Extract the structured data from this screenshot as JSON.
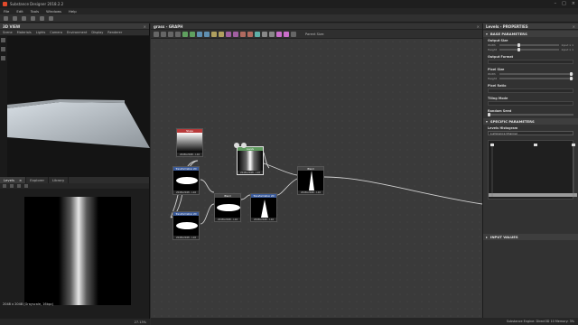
{
  "window": {
    "title": "Substance Designer 2018.2.2"
  },
  "menu": [
    "File",
    "Edit",
    "Tools",
    "Windows",
    "Help"
  ],
  "view3d": {
    "title": "3D VIEW",
    "submenu": [
      "Scene",
      "Materials",
      "Lights",
      "Camera",
      "Environment",
      "Display",
      "Renderer"
    ]
  },
  "view2d": {
    "tabs": [
      "Levels",
      "Explorer",
      "Library"
    ],
    "info": "2048 x 2048 (Grayscale, 16bpc)",
    "zoom": "27.13%"
  },
  "graph": {
    "title": "grass - GRAPH",
    "parent_size_label": "Parent Size:",
    "nodes": [
      {
        "name": "Shape",
        "caption": "2048x2048 - L16"
      },
      {
        "name": "Transformation 2D",
        "caption": "2048x2048 - L16"
      },
      {
        "name": "Transformation 2D",
        "caption": "2048x2048 - L16"
      },
      {
        "name": "Blend",
        "caption": "2048x2048 - L16"
      },
      {
        "name": "Transformation 2D",
        "caption": "2048x2048 - L16"
      },
      {
        "name": "Levels",
        "caption": "2048x2048 - L16"
      },
      {
        "name": "Blend",
        "caption": "2048x2048 - L16"
      }
    ]
  },
  "props": {
    "title": "Levels - PROPERTIES",
    "base_section": "BASE PARAMETERS",
    "output_size": {
      "label": "Output Size",
      "width_label": "Width",
      "height_label": "Height",
      "width_value": "Input x 1",
      "height_value": "Input x 1"
    },
    "output_format": {
      "label": "Output Format"
    },
    "pixel_size": {
      "label": "Pixel Size",
      "width_label": "Width",
      "height_label": "Height"
    },
    "pixel_ratio": {
      "label": "Pixel Ratio"
    },
    "tiling_mode": {
      "label": "Tiling Mode"
    },
    "random_seed": {
      "label": "Random Seed"
    },
    "specific_section": "SPECIFIC PARAMETERS",
    "histogram_label": "Levels Histogram",
    "channel_value": "Luminance Channel",
    "input_section": "INPUT VALUES"
  },
  "status": {
    "engine": "Substance Engine: Direct3D 10   Memory: 3%"
  }
}
